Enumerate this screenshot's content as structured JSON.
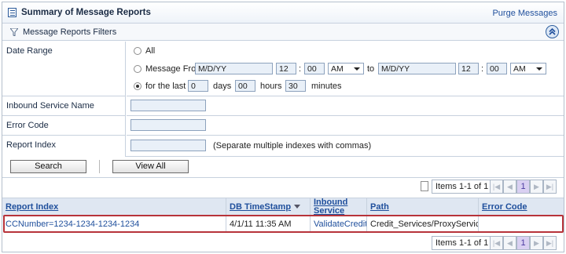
{
  "header": {
    "title": "Summary of Message Reports",
    "purge_link": "Purge Messages"
  },
  "filters_bar": {
    "title": "Message Reports Filters"
  },
  "filters": {
    "date_range": {
      "label": "Date Range",
      "option_all": "All",
      "option_message_from": "Message From",
      "from_date": "M/D/YY",
      "from_hour": "12",
      "colon": ":",
      "from_min": "00",
      "from_ampm": "AM",
      "to_label": "to",
      "to_date": "M/D/YY",
      "to_hour": "12",
      "to_min": "00",
      "to_ampm": "AM",
      "option_last": "for the last",
      "last_days": "0",
      "days_label": "days",
      "last_hours": "00",
      "hours_label": "hours",
      "last_minutes": "30",
      "minutes_label": "minutes",
      "selected": "for the last"
    },
    "inbound_service": {
      "label": "Inbound Service Name",
      "value": ""
    },
    "error_code": {
      "label": "Error Code",
      "value": ""
    },
    "report_index": {
      "label": "Report Index",
      "value": "",
      "hint": "(Separate multiple indexes with commas)"
    }
  },
  "buttons": {
    "search": "Search",
    "view_all": "View All"
  },
  "pager": {
    "items_text": "Items 1-1 of 1",
    "current_page": "1"
  },
  "table": {
    "columns": {
      "report_index": "Report Index",
      "db_timestamp": "DB TimeStamp",
      "inbound_service_line1": "Inbound",
      "inbound_service_line2": "Service",
      "path": "Path",
      "error_code": "Error Code"
    },
    "rows": [
      {
        "report_index": "CCNumber=1234-1234-1234-1234",
        "db_timestamp": "4/1/11 11:35 AM",
        "inbound_service": "ValidateCredit",
        "path": "Credit_Services/ProxyServices",
        "error_code": ""
      }
    ]
  },
  "colors": {
    "link": "#1f4f9c",
    "highlight_border": "#b7333a",
    "header_bg": "#dfe7f2",
    "page_active": "#d9d0f2"
  }
}
